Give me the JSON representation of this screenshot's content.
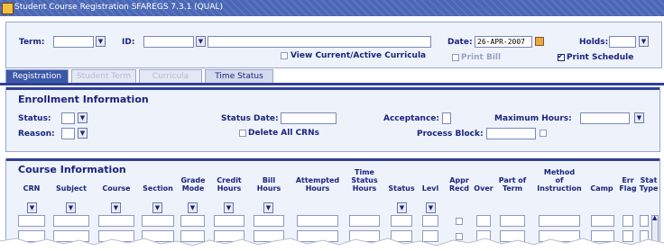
{
  "window": {
    "title": "Student Course Registration  SFAREGS  7.3.1  (QUAL)"
  },
  "key_block": {
    "term_label": "Term:",
    "id_label": "ID:",
    "date_label": "Date:",
    "date_value": "26-APR-2007",
    "holds_label": "Holds:",
    "view_curricula_label": "View Current/Active Curricula",
    "print_bill_label": "Print Bill",
    "print_schedule_label": "Print Schedule"
  },
  "tabs": [
    {
      "label": "Registration",
      "state": "active"
    },
    {
      "label": "Student Term",
      "state": "disabled"
    },
    {
      "label": "Curricula",
      "state": "disabled"
    },
    {
      "label": "Time Status",
      "state": "normal"
    }
  ],
  "enrollment": {
    "title": "Enrollment Information",
    "status_label": "Status:",
    "reason_label": "Reason:",
    "status_date_label": "Status Date:",
    "delete_all_label": "Delete All CRNs",
    "acceptance_label": "Acceptance:",
    "process_block_label": "Process Block:",
    "max_hours_label": "Maximum Hours:"
  },
  "course": {
    "title": "Course Information",
    "columns": [
      "CRN",
      "Subject",
      "Course",
      "Section",
      "Grade\nMode",
      "Credit\nHours",
      "Bill\nHours",
      "Attempted\nHours",
      "Time\nStatus\nHours",
      "Status",
      "Levl",
      "Appr\nRecd",
      "Over",
      "Part of\nTerm",
      "Method\nof\nInstruction",
      "Camp",
      "Err\nFlag",
      "Stat\nType"
    ]
  },
  "icons": {
    "dropdown": "chevron-down-icon",
    "calendar": "calendar-icon",
    "scroll_up": "arrow-up-icon"
  },
  "colors": {
    "title_bar": "#4a67b6",
    "accent": "#2f3f9a",
    "panel": "#eef2fb",
    "label": "#1a237e"
  }
}
